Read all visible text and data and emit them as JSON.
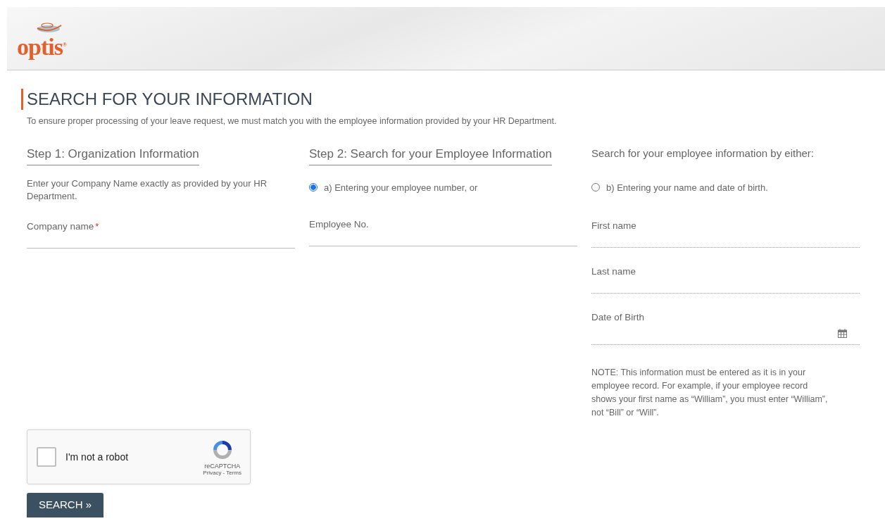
{
  "logo": {
    "text": "optis$^{®}$"
  },
  "title": "SEARCH FOR YOUR INFORMATION",
  "intro": "To ensure proper processing of your leave request, we must match you with the employee information provided by your HR Department.",
  "step1": {
    "heading": "Step 1: Organization Information",
    "hint": "Enter your Company Name exactly as provided by your HR Department.",
    "field": {
      "label": "Company name",
      "required_mark": "*"
    }
  },
  "step2": {
    "heading": "Step 2: Search for your Employee Information",
    "option": {
      "label": "a) Entering your employee number, or",
      "selected": true
    },
    "field": {
      "label": "Employee No."
    }
  },
  "step3": {
    "heading": "Search for your employee information by either:",
    "option": {
      "label": "b) Entering your name and date of birth.",
      "selected": false
    },
    "fields": [
      {
        "label": "First name",
        "kind": "text"
      },
      {
        "label": "Last name",
        "kind": "text"
      },
      {
        "label": "Date of Birth",
        "kind": "date"
      }
    ],
    "note": "NOTE: This information must be entered as it is in your employee record. For example, if your employee record shows your first name as “William”, you must enter “William”, not “Bill” or “Will”."
  },
  "captcha": {
    "label": "I'm not a robot",
    "checked": false,
    "brand": "reCAPTCHA",
    "privacy": "Privacy",
    "separator": "-",
    "terms": "Terms"
  },
  "submit": "SEARCH »"
}
